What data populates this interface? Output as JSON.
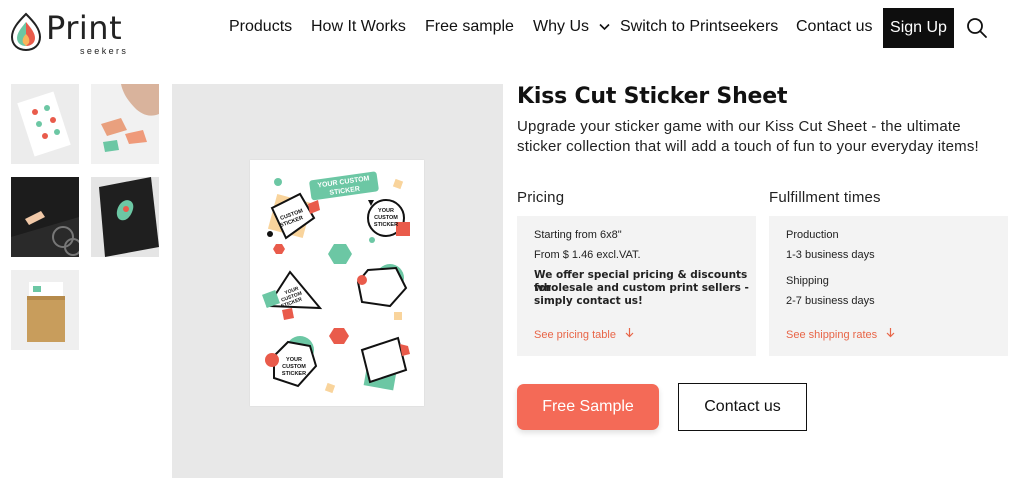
{
  "brand": {
    "name": "Print",
    "tagline": "seekers"
  },
  "nav": {
    "products": "Products",
    "how_it_works": "How It Works",
    "free_sample": "Free sample",
    "why_us": "Why Us",
    "switch": "Switch to Printseekers",
    "contact": "Contact us",
    "sign_up": "Sign Up"
  },
  "gallery": {
    "thumbnails": [
      "sticker-sheet-flatlay",
      "hand-peeling-sticker",
      "laptop-with-sticker",
      "notebook-with-sticker",
      "kraft-envelope-packaging"
    ],
    "sheet": {
      "banner": "YOUR CUSTOM STICKER",
      "sticker_line1": "YOUR",
      "sticker_line2": "CUSTOM",
      "sticker_line3": "STICKER"
    }
  },
  "product": {
    "title": "Kiss Cut Sticker Sheet",
    "description": "Upgrade your sticker game with our Kiss Cut Sheet - the ultimate sticker collection that will add a touch of fun to your everyday items!"
  },
  "pricing": {
    "heading": "Pricing",
    "starting": "Starting from 6x8\"",
    "price": "From $ 1.46 excl.VAT.",
    "special_line1": "We offer special pricing & discounts for",
    "special_line2": "wholesale and custom print sellers -",
    "special_line3": "simply contact us!",
    "link": "See pricing table"
  },
  "fulfillment": {
    "heading": "Fulfillment times",
    "production_label": "Production",
    "production_value": "1-3 business days",
    "shipping_label": "Shipping",
    "shipping_value": "2-7 business days",
    "link": "See shipping rates"
  },
  "actions": {
    "free_sample": "Free Sample",
    "contact": "Contact us"
  },
  "colors": {
    "accent": "#f46a57",
    "link": "#e86547",
    "mint": "#6cc7a4",
    "red": "#e95b4b",
    "peach": "#f9d49c",
    "dark": "#0e0e0e"
  }
}
